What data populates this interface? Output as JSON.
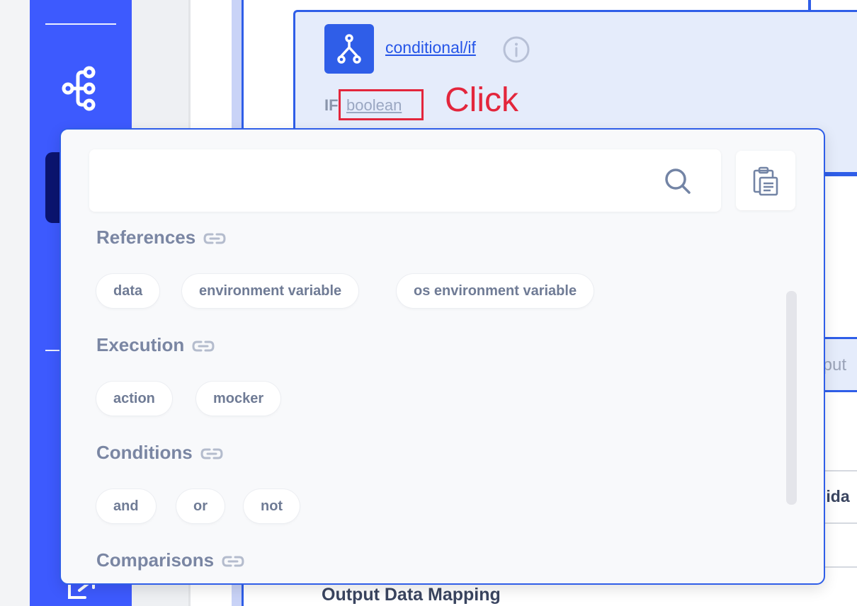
{
  "node": {
    "title": "conditional/if",
    "if_label": "IF",
    "condition_link": "boolean"
  },
  "annotation": {
    "click_label": "Click",
    "highlight_color": "#e3263c"
  },
  "background": {
    "output_fragment": "tput",
    "valid_fragment": "lida",
    "output_mapping": "Output Data Mapping"
  },
  "popup": {
    "search": {
      "value": "",
      "placeholder": ""
    },
    "sections": [
      {
        "title": "References",
        "items": [
          "data",
          "environment variable",
          "os environment variable"
        ]
      },
      {
        "title": "Execution",
        "items": [
          "action",
          "mocker"
        ]
      },
      {
        "title": "Conditions",
        "items": [
          "and",
          "or",
          "not"
        ]
      },
      {
        "title": "Comparisons",
        "items": []
      }
    ]
  },
  "colors": {
    "sidebar": "#3d5afe",
    "accent": "#2f5ee8",
    "section_text": "#7a86a3",
    "chip_text": "#6f7b95"
  }
}
